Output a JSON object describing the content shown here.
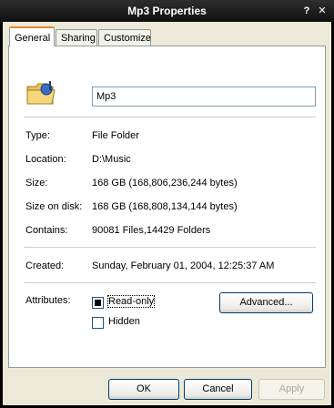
{
  "window": {
    "title": "Mp3 Properties",
    "help_glyph": "?",
    "close_glyph": "✕"
  },
  "tabs": [
    {
      "label": "General",
      "active": true
    },
    {
      "label": "Sharing",
      "active": false
    },
    {
      "label": "Customize",
      "active": false
    }
  ],
  "general": {
    "folder_name": "Mp3",
    "properties": [
      {
        "label": "Type:",
        "value": "File Folder"
      },
      {
        "label": "Location:",
        "value": "D:\\Music"
      },
      {
        "label": "Size:",
        "value": "168  GB (168,806,236,244 bytes)"
      },
      {
        "label": "Size on disk:",
        "value": "168  GB (168,808,134,144 bytes)"
      },
      {
        "label": "Contains:",
        "value": "90081 Files,14429 Folders"
      }
    ],
    "created": {
      "label": "Created:",
      "value": "Sunday, February 01, 2004, 12:25:37 AM"
    },
    "attributes": {
      "label": "Attributes:",
      "read_only": {
        "label": "Read-only",
        "state": "indeterminate"
      },
      "hidden": {
        "label": "Hidden",
        "state": "unchecked"
      },
      "advanced_label": "Advanced..."
    }
  },
  "footer": {
    "ok_label": "OK",
    "cancel_label": "Cancel",
    "apply_label": "Apply"
  },
  "colors": {
    "titlebar": "#1c1c1c",
    "dialog_bg": "#ece9d8",
    "active_tab_accent": "#e68b2c"
  }
}
